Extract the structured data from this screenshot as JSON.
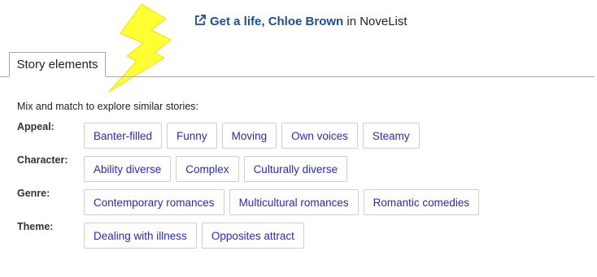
{
  "header": {
    "link_title": "Get a life, Chloe Brown",
    "link_suffix": " in NoveList",
    "link_icon": "external-link-icon",
    "accent_color": "#1f4f8f"
  },
  "tabs": [
    {
      "label": "Story elements"
    }
  ],
  "intro": "Mix and match to explore similar stories:",
  "facets": [
    {
      "label": "Appeal:",
      "items": [
        "Banter-filled",
        "Funny",
        "Moving",
        "Own voices",
        "Steamy"
      ]
    },
    {
      "label": "Character:",
      "items": [
        "Ability diverse",
        "Complex",
        "Culturally diverse"
      ]
    },
    {
      "label": "Genre:",
      "items": [
        "Contemporary romances",
        "Multicultural romances",
        "Romantic comedies"
      ]
    },
    {
      "label": "Theme:",
      "items": [
        "Dealing with illness",
        "Opposites attract"
      ]
    }
  ],
  "decoration": {
    "icon": "lightning-bolt-icon",
    "color": "#ffff33"
  }
}
